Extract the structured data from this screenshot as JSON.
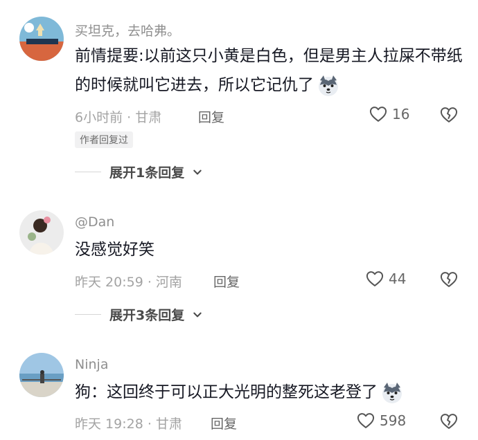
{
  "comments": [
    {
      "username": "买坦克，去哈弗。",
      "text": "前情提要:以前这只小黄是白色，但是男主人拉屎不带纸的时候就叫它进去，所以它记仇了",
      "time_location": "6小时前 · 甘肃",
      "reply_label": "回复",
      "likes": "16",
      "author_tag": "作者回复过",
      "expand_label": "展开1条回复"
    },
    {
      "username": "@Dan",
      "text": "没感觉好笑",
      "time_location": "昨天 20:59 · 河南",
      "reply_label": "回复",
      "likes": "44",
      "expand_label": "展开3条回复"
    },
    {
      "username": "Ninja",
      "text": "狗：这回终于可以正大光明的整死这老登了",
      "time_location": "昨天 19:28 · 甘肃",
      "reply_label": "回复",
      "likes": "598"
    }
  ],
  "icons": {
    "like": "heart-outline-icon",
    "dislike": "broken-heart-icon",
    "expand": "chevron-down-icon",
    "emoji": "husky-dog-emoji"
  },
  "colors": {
    "text": "#161823",
    "meta": "#a3a3a3",
    "username": "#8f8f8f"
  }
}
